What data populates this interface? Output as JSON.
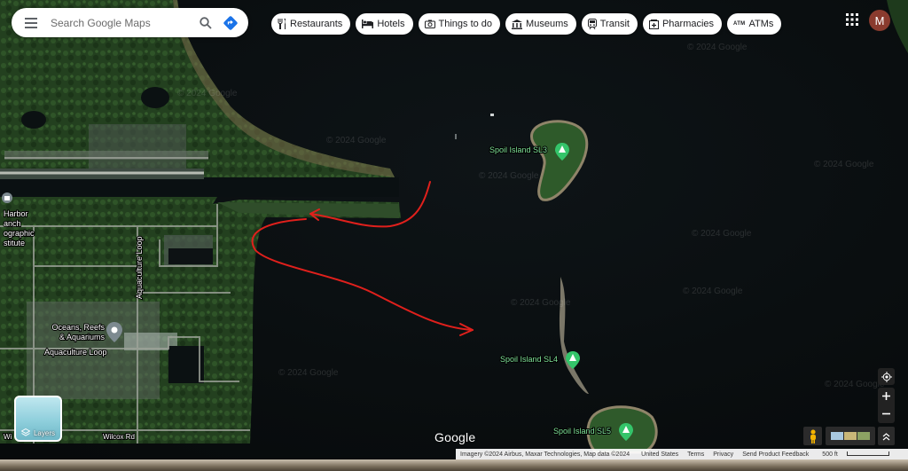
{
  "search": {
    "placeholder": "Search Google Maps"
  },
  "chips": [
    {
      "label": "Restaurants",
      "icon": "fork-knife-icon"
    },
    {
      "label": "Hotels",
      "icon": "bed-icon"
    },
    {
      "label": "Things to do",
      "icon": "camera-icon"
    },
    {
      "label": "Museums",
      "icon": "museum-icon"
    },
    {
      "label": "Transit",
      "icon": "train-icon"
    },
    {
      "label": "Pharmacies",
      "icon": "pharmacy-icon"
    },
    {
      "label": "ATMs",
      "icon": "atm-icon",
      "tag": "ATM"
    }
  ],
  "account": {
    "initial": "M"
  },
  "places": {
    "spoil_sl3": "Spoil Island SL3",
    "spoil_sl4": "Spoil Island SL4",
    "spoil_sl5": "Spoil Island SL5",
    "harbor_line1": "Harbor",
    "harbor_line2": "anch",
    "harbor_line3": "ographic",
    "harbor_line4": "stitute",
    "oceans_line1": "Oceans, Reefs",
    "oceans_line2": "& Aquariums"
  },
  "roads": {
    "aquaculture_loop_v": "Aquaculture Loop",
    "aquaculture_loop_h": "Aquaculture Loop",
    "wilcox": "Wilcox Rd",
    "wi_partial": "Wi"
  },
  "watermark": "© 2024 Google",
  "layers_label": "Layers",
  "google_logo": "Google",
  "attribution": {
    "imagery": "Imagery ©2024 Airbus, Maxar Technologies, Map data ©2024",
    "country": "United States",
    "terms": "Terms",
    "privacy": "Privacy",
    "feedback": "Send Product Feedback",
    "scale": "500 ft"
  },
  "colors": {
    "pin_green": "#34c46a",
    "annotation_red": "#e0201c",
    "label_green": "#7fe39a"
  }
}
